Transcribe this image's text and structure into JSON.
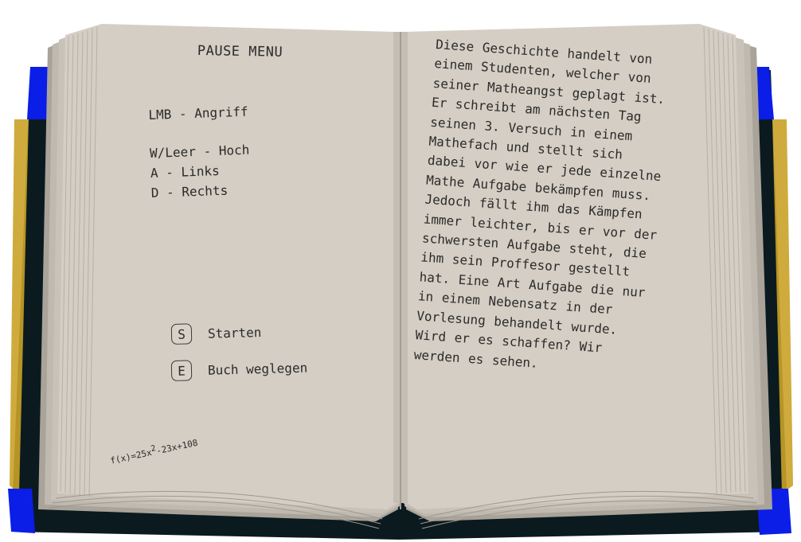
{
  "left_page": {
    "title": "PAUSE MENU",
    "controls": [
      "LMB - Angriff",
      "W/Leer - Hoch",
      "A - Links",
      "D - Rechts"
    ],
    "menu": [
      {
        "key": "S",
        "label": "Starten"
      },
      {
        "key": "E",
        "label": "Buch weglegen"
      }
    ],
    "formula": {
      "base": "f(x)=25x",
      "exp": "2",
      "rest": "-23x+108"
    }
  },
  "right_page": {
    "story": "Diese Geschichte handelt von einem Studenten, welcher von seiner Matheangst geplagt ist. Er schreibt am nächsten Tag seinen 3. Versuch in einem Mathefach und stellt sich dabei vor wie er jede einzelne Mathe Aufgabe bekämpfen muss. Jedoch fällt ihm das Kämpfen immer leichter, bis er vor der schwersten Aufgabe steht, die ihm sein Proffesor gestellt hat. Eine Art Aufgabe die nur in einem Nebensatz in der Vorlesung behandelt wurde. Wird er es schaffen? Wir werden es sehen."
  },
  "colors": {
    "cover": "#0b1a1f",
    "corner": "#0a1ee8",
    "spine_edge": "#c9a227",
    "page": "#d4cec4",
    "page_edge": "#b9b3a9"
  }
}
